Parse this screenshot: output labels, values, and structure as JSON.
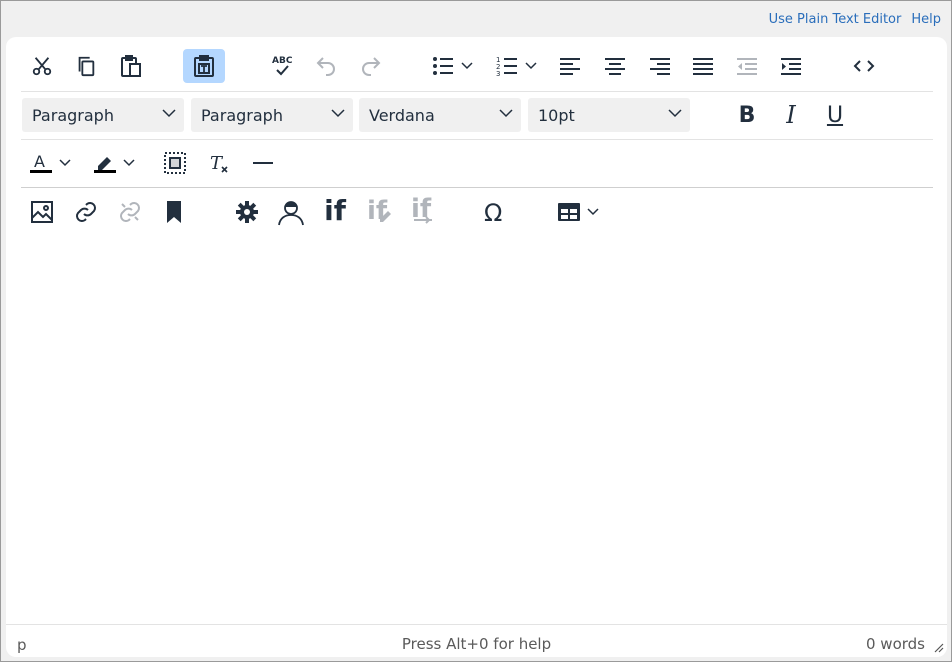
{
  "links": {
    "plain_text": "Use Plain Text Editor",
    "help": "Help"
  },
  "toolbar": {
    "formats": [
      {
        "label": "Paragraph"
      },
      {
        "label": "Paragraph"
      },
      {
        "label": "Verdana"
      },
      {
        "label": "10pt"
      }
    ],
    "bold": "B",
    "italic": "I",
    "underline": "U",
    "if_label": "if"
  },
  "status": {
    "path": "p",
    "help": "Press Alt+0 for help",
    "words": "0 words"
  },
  "colors": {
    "icon": "#222f3e",
    "link": "#2a6ebb",
    "active": "#b4d7ff"
  }
}
